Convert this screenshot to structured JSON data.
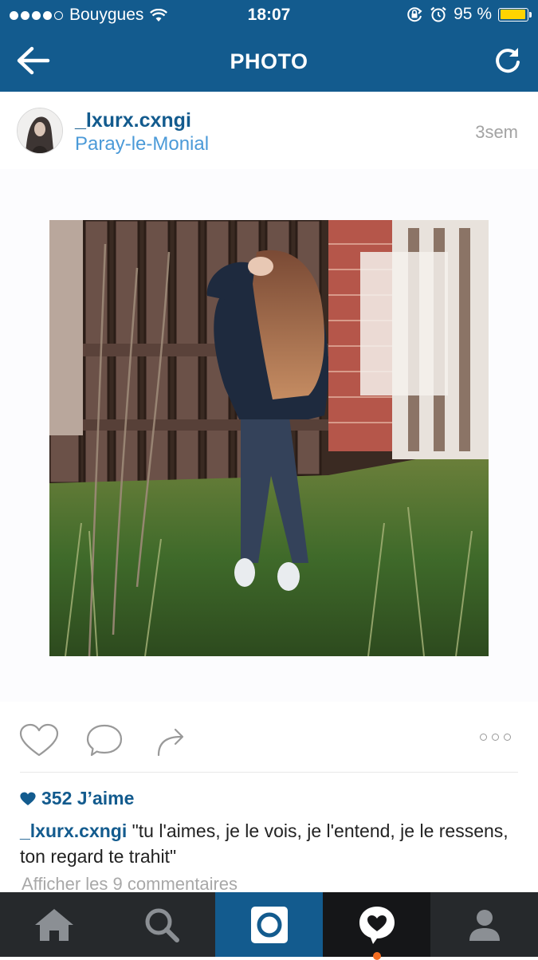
{
  "status": {
    "carrier": "Bouygues",
    "time": "18:07",
    "battery": "95 %",
    "battery_level": 0.95
  },
  "nav": {
    "title": "PHOTO"
  },
  "post": {
    "username": "_lxurx.cxngi",
    "location": "Paray-le-Monial",
    "time_ago": "3sem"
  },
  "likes": {
    "count_label": "352 J’aime"
  },
  "caption": {
    "user": "_lxurx.cxngi",
    "text": "\"tu l'aimes, je le vois, je l'entend, je le ressens, ton regard te trahit\""
  },
  "comments_link": "Afficher les 9 commentaires",
  "colors": {
    "brand_blue": "#135b8e",
    "link_blue": "#4b9ad8",
    "tab_bar": "#26292c",
    "notification": "#f36d21"
  },
  "icons": {
    "back": "arrow-left-icon",
    "refresh": "refresh-icon",
    "like": "heart-outline-icon",
    "comment": "comment-bubble-icon",
    "share": "share-arrow-icon",
    "more": "more-dots-icon",
    "tabs": [
      "home-icon",
      "search-icon",
      "camera-icon",
      "activity-heart-icon",
      "profile-icon"
    ]
  }
}
